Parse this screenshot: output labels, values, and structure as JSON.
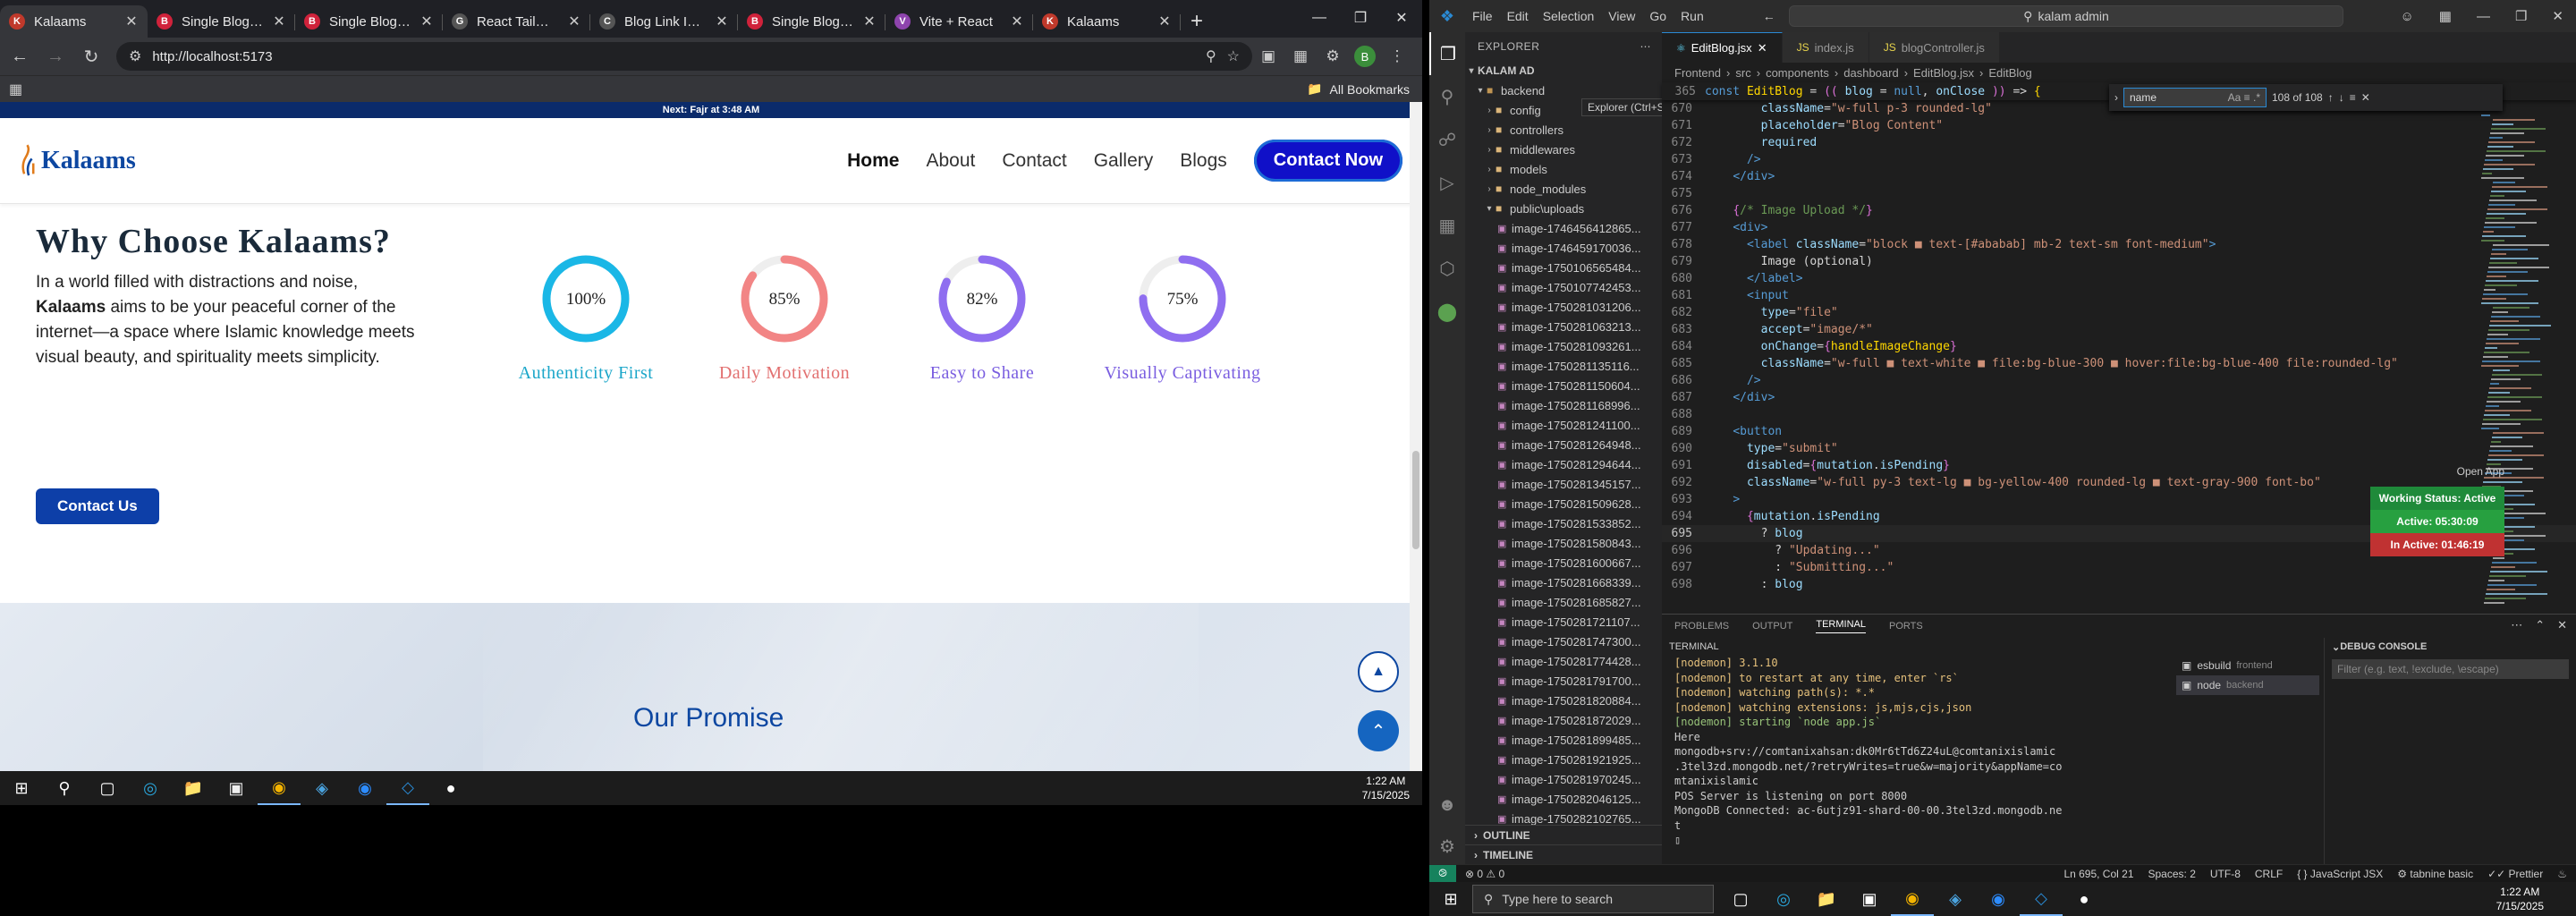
{
  "chrome": {
    "tabs": [
      {
        "title": "Kalaams",
        "fav_color": "#c0392b",
        "fav": "K",
        "active": true
      },
      {
        "title": "Single Blog Posts",
        "fav_color": "#d0223b",
        "fav": "B",
        "active": false
      },
      {
        "title": "Single Blog Posts",
        "fav_color": "#d0223b",
        "fav": "B",
        "active": false
      },
      {
        "title": "React Tailwind Blog",
        "fav_color": "#555",
        "fav": "G",
        "active": false
      },
      {
        "title": "Blog Link Issue Debug",
        "fav_color": "#555",
        "fav": "C",
        "active": false
      },
      {
        "title": "Single Blog Posts",
        "fav_color": "#d0223b",
        "fav": "B",
        "active": false
      },
      {
        "title": "Vite + React",
        "fav_color": "#8e44ad",
        "fav": "V",
        "active": false
      },
      {
        "title": "Kalaams",
        "fav_color": "#c0392b",
        "fav": "K",
        "active": false
      }
    ],
    "url": "http://localhost:5173",
    "bookmarks_label": "All Bookmarks"
  },
  "site": {
    "announcement": "Next: Fajr at 3:48 AM",
    "logo_text": "Kalaams",
    "nav": [
      "Home",
      "About",
      "Contact",
      "Gallery",
      "Blogs"
    ],
    "nav_active": "Home",
    "cta": "Contact Now",
    "why_title": "Why Choose Kalaams?",
    "why_text_before": "In a world filled with distractions and noise, ",
    "why_text_bold": "Kalaams",
    "why_text_after": " aims to be your peaceful corner of the internet—a space where Islamic knowledge meets visual beauty, and spirituality meets simplicity.",
    "contact_us": "Contact Us",
    "stats": [
      {
        "value": "100%",
        "pct": 1.0,
        "label": "Authenticity First",
        "color": "#1ab7e6",
        "label_color": "#1aa6c9"
      },
      {
        "value": "85%",
        "pct": 0.85,
        "label": "Daily Motivation",
        "color": "#f28585",
        "label_color": "#e27070"
      },
      {
        "value": "82%",
        "pct": 0.82,
        "label": "Easy to Share",
        "color": "#8f6ef0",
        "label_color": "#7a5ee0"
      },
      {
        "value": "75%",
        "pct": 0.75,
        "label": "Visually Captivating",
        "color": "#8f6ef0",
        "label_color": "#7a5ee0"
      }
    ],
    "promise_title": "Our Promise"
  },
  "taskbar_left": {
    "time": "1:22 AM",
    "date": "7/15/2025"
  },
  "vscode": {
    "menu": [
      "File",
      "Edit",
      "Selection",
      "View",
      "Go",
      "Run"
    ],
    "search": "kalam admin",
    "explorer_title": "EXPLORER",
    "tooltip": "Explorer (Ctrl+Shift+E)",
    "root": "KALAM AD",
    "tree": [
      {
        "name": "backend",
        "type": "folder-open",
        "depth": 1
      },
      {
        "name": "config",
        "type": "folder",
        "depth": 2
      },
      {
        "name": "controllers",
        "type": "folder",
        "depth": 2
      },
      {
        "name": "middlewares",
        "type": "folder",
        "depth": 2
      },
      {
        "name": "models",
        "type": "folder",
        "depth": 2
      },
      {
        "name": "node_modules",
        "type": "folder",
        "depth": 2
      },
      {
        "name": "public\\uploads",
        "type": "folder-open",
        "depth": 2
      }
    ],
    "files": [
      "image-1746456412865...",
      "image-1746459170036...",
      "image-1750106565484...",
      "image-1750107742453...",
      "image-1750281031206...",
      "image-1750281063213...",
      "image-1750281093261...",
      "image-1750281135116...",
      "image-1750281150604...",
      "image-1750281168996...",
      "image-1750281241100...",
      "image-1750281264948...",
      "image-1750281294644...",
      "image-1750281345157...",
      "image-1750281509628...",
      "image-1750281533852...",
      "image-1750281580843...",
      "image-1750281600667...",
      "image-1750281668339...",
      "image-1750281685827...",
      "image-1750281721107...",
      "image-1750281747300...",
      "image-1750281774428...",
      "image-1750281791700...",
      "image-1750281820884...",
      "image-1750281872029...",
      "image-1750281899485...",
      "image-1750281921925...",
      "image-1750281970245...",
      "image-1750282046125...",
      "image-1750282102765..."
    ],
    "outline": "OUTLINE",
    "timeline": "TIMELINE",
    "editor_tabs": [
      "EditBlog.jsx",
      "index.js",
      "blogController.js"
    ],
    "breadcrumb": [
      "Frontend",
      "src",
      "components",
      "dashboard",
      "EditBlog.jsx",
      "EditBlog"
    ],
    "sticky_num": "365",
    "find_text": "name",
    "find_count": "108 of 108",
    "code_lines": [
      {
        "n": "670"
      },
      {
        "n": "671"
      },
      {
        "n": "672"
      },
      {
        "n": "673"
      },
      {
        "n": "674"
      },
      {
        "n": "675"
      },
      {
        "n": "676"
      },
      {
        "n": "677"
      },
      {
        "n": "678"
      },
      {
        "n": "679"
      },
      {
        "n": "680"
      },
      {
        "n": "681"
      },
      {
        "n": "682"
      },
      {
        "n": "683"
      },
      {
        "n": "684"
      },
      {
        "n": "685"
      },
      {
        "n": "686"
      },
      {
        "n": "687"
      },
      {
        "n": "688"
      },
      {
        "n": "689"
      },
      {
        "n": "690"
      },
      {
        "n": "691"
      },
      {
        "n": "692"
      },
      {
        "n": "693"
      },
      {
        "n": "694"
      },
      {
        "n": "695"
      },
      {
        "n": "696"
      },
      {
        "n": "697"
      },
      {
        "n": "698"
      }
    ],
    "open_app": "Open App",
    "work_status": "Working Status: Active",
    "active_time": "Active: 05:30:09",
    "inactive_time": "In Active: 01:46:19",
    "panel_tabs": [
      "PROBLEMS",
      "OUTPUT",
      "TERMINAL",
      "PORTS"
    ],
    "terminal_title": "TERMINAL",
    "terminal_lines": [
      {
        "text": "[nodemon] 3.1.10",
        "color": "#e5c07b"
      },
      {
        "text": "[nodemon] to restart at any time, enter `rs`",
        "color": "#e5c07b"
      },
      {
        "text": "[nodemon] watching path(s): *.*",
        "color": "#e5c07b"
      },
      {
        "text": "[nodemon] watching extensions: js,mjs,cjs,json",
        "color": "#e5c07b"
      },
      {
        "text": "[nodemon] starting `node app.js`",
        "color": "#98c379"
      },
      {
        "text": "Here",
        "color": "#cccccc"
      },
      {
        "text": "mongodb+srv://comtanixahsan:dk0Mr6tTd6Z24uL@comtanixislamic",
        "color": "#cccccc"
      },
      {
        "text": ".3tel3zd.mongodb.net/?retryWrites=true&w=majority&appName=co",
        "color": "#cccccc"
      },
      {
        "text": "mtanixislamic",
        "color": "#cccccc"
      },
      {
        "text": "POS Server is listening on port 8000",
        "color": "#cccccc"
      },
      {
        "text": "MongoDB Connected: ac-6utjz91-shard-00-00.3tel3zd.mongodb.ne",
        "color": "#cccccc"
      },
      {
        "text": "t",
        "color": "#cccccc"
      }
    ],
    "terminal_list": [
      {
        "name": "esbuild",
        "sub": "frontend"
      },
      {
        "name": "node",
        "sub": "backend"
      }
    ],
    "debug_title": "DEBUG CONSOLE",
    "debug_filter": "Filter (e.g. text, !exclude, \\escape)",
    "status": {
      "errors": "0",
      "warnings": "0",
      "pos": "Ln 695, Col 21",
      "spaces": "Spaces: 2",
      "enc": "UTF-8",
      "eol": "CRLF",
      "lang": "JavaScript JSX",
      "tabnine": "tabnine basic",
      "prettier": "Prettier"
    }
  },
  "taskbar_right": {
    "search": "Type here to search",
    "time": "1:22 AM",
    "date": "7/15/2025"
  }
}
